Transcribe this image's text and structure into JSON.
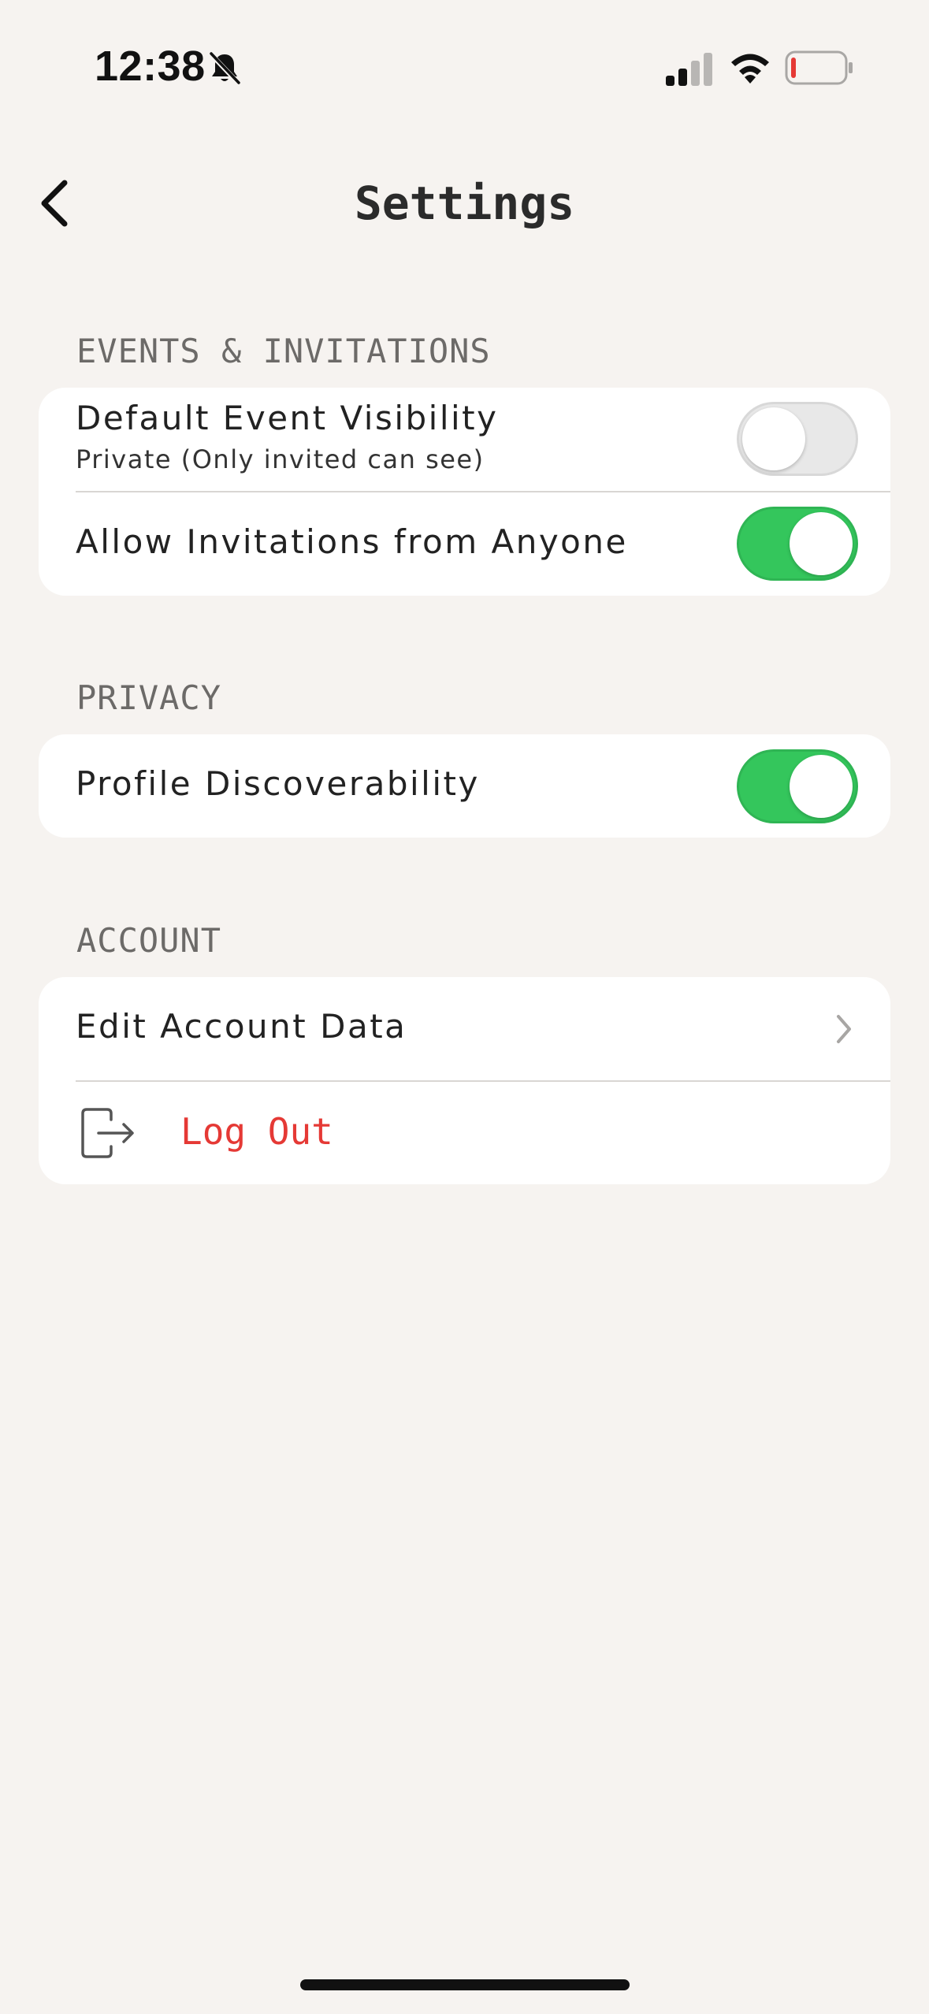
{
  "status_bar": {
    "time": "12:38",
    "icons": [
      "bell-slash-icon",
      "cellular-signal-icon",
      "wifi-icon",
      "battery-low-icon"
    ],
    "battery_color": "#e53935"
  },
  "header": {
    "title": "Settings",
    "back_icon": "chevron-left-icon"
  },
  "sections": {
    "events": {
      "header": "EVENTS & INVITATIONS",
      "default_visibility": {
        "label": "Default Event Visibility",
        "sublabel": "Private (Only invited can see)",
        "toggle_on": false
      },
      "allow_invitations": {
        "label": "Allow Invitations from Anyone",
        "toggle_on": true
      }
    },
    "privacy": {
      "header": "PRIVACY",
      "profile_discoverability": {
        "label": "Profile Discoverability",
        "toggle_on": true
      }
    },
    "account": {
      "header": "ACCOUNT",
      "edit_account": {
        "label": "Edit Account Data",
        "icon": "chevron-right-icon"
      },
      "log_out": {
        "label": "Log Out",
        "icon": "logout-icon",
        "color": "#e53935"
      }
    }
  },
  "colors": {
    "background": "#f6f3f0",
    "card": "#ffffff",
    "toggle_on": "#34c65c",
    "toggle_off": "#e8e8e8",
    "section_header": "#6c6a68"
  }
}
